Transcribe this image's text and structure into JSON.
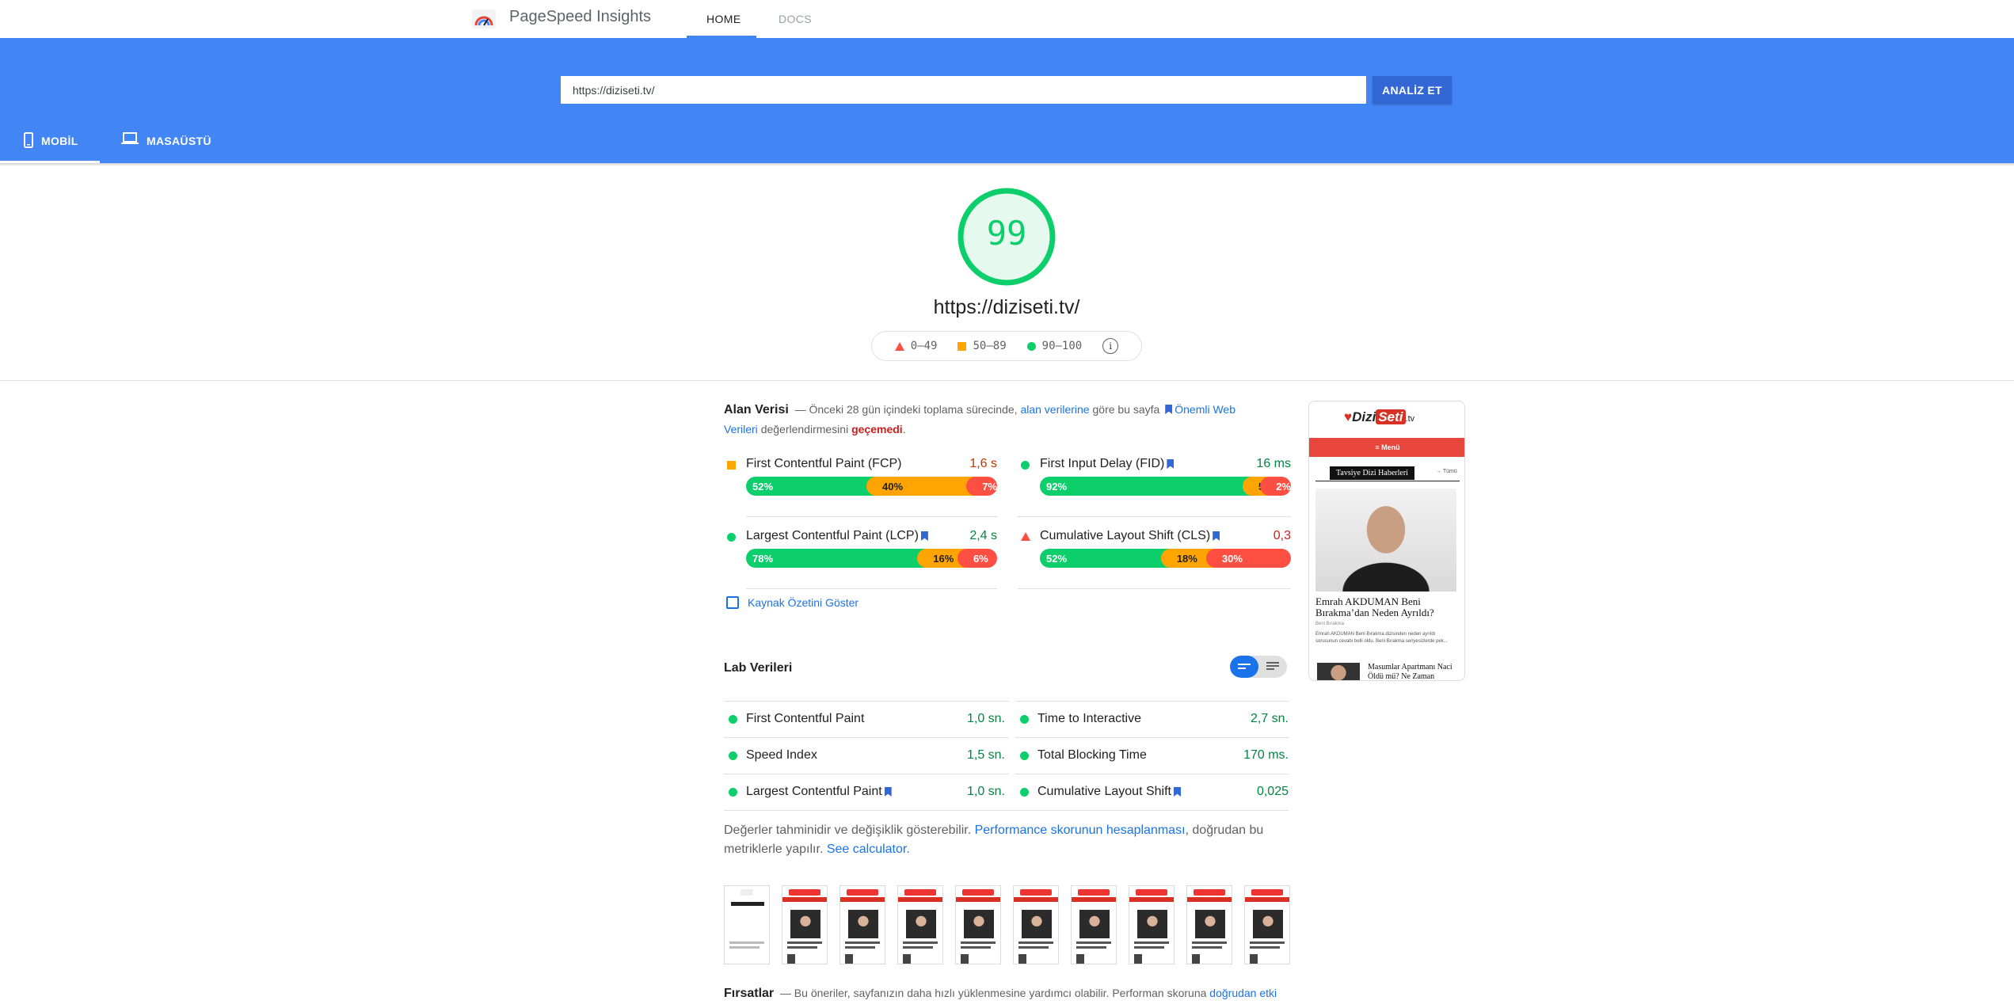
{
  "app": {
    "title": "PageSpeed Insights"
  },
  "nav": {
    "home": "HOME",
    "docs": "DOCS"
  },
  "search": {
    "url": "https://diziseti.tv/",
    "button": "ANALİZ ET"
  },
  "device_tabs": {
    "mobile": "MOBİL",
    "desktop": "MASAÜSTÜ"
  },
  "score": {
    "value": "99",
    "url": "https://diziseti.tv/",
    "color": "#0cce6b"
  },
  "legend": {
    "poor": "0–49",
    "average": "50–89",
    "good": "90–100"
  },
  "field": {
    "title": "Alan Verisi",
    "desc_1": "— Önceki 28 gün içindeki toplama sürecinde,",
    "desc_link_1": "alan verilerine",
    "desc_2": "göre bu sayfa",
    "desc_link_2": "Önemli Web Verileri",
    "desc_3": "değerlendirmesini",
    "desc_fail": "geçemedi",
    "desc_end": ".",
    "metrics": [
      {
        "name": "First Contentful Paint (FCP)",
        "value": "1,6 s",
        "rating": "average",
        "dist": [
          "52%",
          "40%",
          "7%"
        ]
      },
      {
        "name": "First Input Delay (FID)",
        "value": "16 ms",
        "rating": "good",
        "dist": [
          "92%",
          "5%",
          "2%"
        ]
      },
      {
        "name": "Largest Contentful Paint (LCP)",
        "value": "2,4 s",
        "rating": "good",
        "dist": [
          "78%",
          "16%",
          "6%"
        ]
      },
      {
        "name": "Cumulative Layout Shift (CLS)",
        "value": "0,3",
        "rating": "poor",
        "dist": [
          "52%",
          "18%",
          "30%"
        ]
      }
    ],
    "origin_link": "Kaynak Özetini Göster"
  },
  "lab": {
    "title": "Lab Verileri",
    "metrics": [
      {
        "name": "First Contentful Paint",
        "value": "1,0 sn."
      },
      {
        "name": "Time to Interactive",
        "value": "2,7 sn."
      },
      {
        "name": "Speed Index",
        "value": "1,5 sn."
      },
      {
        "name": "Total Blocking Time",
        "value": "170 ms."
      },
      {
        "name": "Largest Contentful Paint",
        "value": "1,0 sn."
      },
      {
        "name": "Cumulative Layout Shift",
        "value": "0,025"
      }
    ],
    "note_1": "Değerler tahminidir ve değişiklik gösterebilir.",
    "note_link": "Performance skorunun hesaplanması",
    "note_2": ", doğrudan bu metriklerle yapılır.",
    "note_calc": "See calculator."
  },
  "opportunities": {
    "title": "Fırsatlar",
    "desc": "— Bu öneriler, sayfanızın daha hızlı yüklenmesine yardımcı olabilir. Performan skoruna",
    "link": "doğrudan etki"
  },
  "phone_preview": {
    "logo_1": "Dizi",
    "logo_2": "Seti",
    "logo_3": ".tv",
    "menu": "≡ Menü",
    "section": "Tavsiye Dizi Haberleri",
    "all": "→ Tümü",
    "headline": "Emrah AKDUMAN Beni Bırakma’dan Neden Ayrıldı?",
    "author": "Beni Bırakma",
    "excerpt": "Emrah AKDUMAN Beni Bırakma dizisinden neden ayrıldı sorusunun cevabı belli oldu. Beni Bırakma seriyesizlerde pek...",
    "headline_2": "Masumlar Apartmanı Naci Öldü mü? Ne Zaman"
  }
}
